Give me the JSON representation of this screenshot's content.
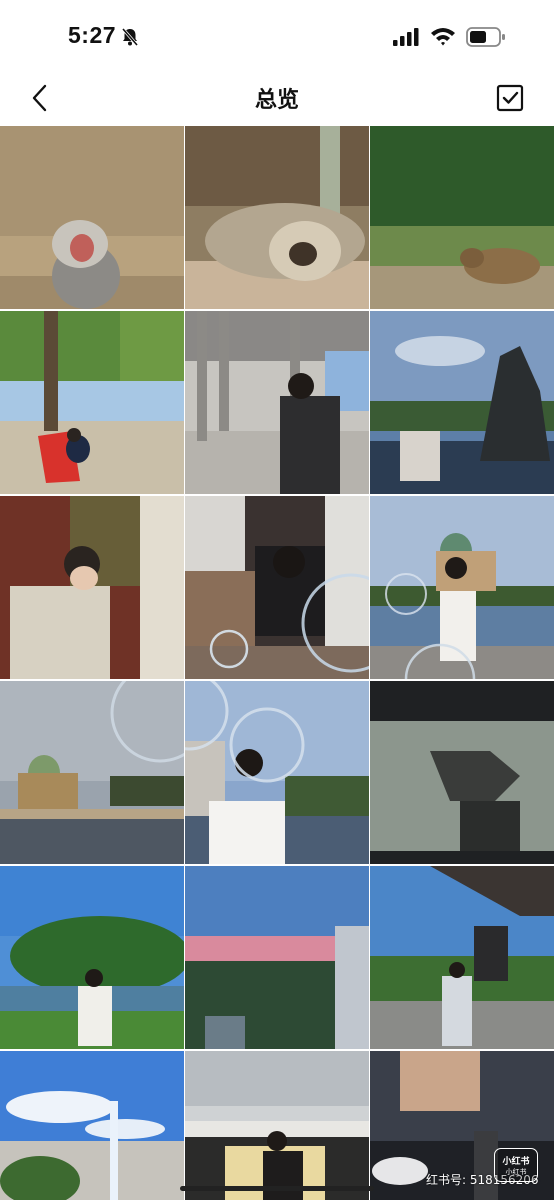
{
  "status_bar": {
    "time": "5:27",
    "icons": [
      "bell-slash-icon",
      "signal-icon",
      "wifi-icon",
      "battery-icon"
    ]
  },
  "nav": {
    "title": "总览",
    "back_icon": "chevron-left-icon",
    "select_icon": "checkbox-icon"
  },
  "grid": {
    "photos": [
      {
        "id": "photo-baboon",
        "icon": "baboon-photo"
      },
      {
        "id": "photo-sloth",
        "icon": "sloth-photo"
      },
      {
        "id": "photo-capybara",
        "icon": "capybara-photo"
      },
      {
        "id": "photo-park-chair",
        "icon": "park-chair-photo"
      },
      {
        "id": "photo-pavilion",
        "icon": "pavilion-photo"
      },
      {
        "id": "photo-fountain",
        "icon": "fountain-photo"
      },
      {
        "id": "photo-brick-wall",
        "icon": "brick-wall-photo"
      },
      {
        "id": "photo-kneeling",
        "icon": "kneeling-photo"
      },
      {
        "id": "photo-cathedral-river",
        "icon": "cathedral-river-photo"
      },
      {
        "id": "photo-cathedral-bridge",
        "icon": "cathedral-bridge-photo"
      },
      {
        "id": "photo-back-view",
        "icon": "back-view-photo"
      },
      {
        "id": "photo-screen",
        "icon": "screen-photo"
      },
      {
        "id": "photo-lake-park",
        "icon": "lake-park-photo"
      },
      {
        "id": "photo-sunset-city",
        "icon": "sunset-city-photo"
      },
      {
        "id": "photo-station",
        "icon": "station-photo"
      },
      {
        "id": "photo-fountain-sky",
        "icon": "fountain-sky-photo"
      },
      {
        "id": "photo-store",
        "icon": "store-photo"
      },
      {
        "id": "photo-night-street",
        "icon": "night-street-photo"
      }
    ]
  },
  "watermark": {
    "text": "红书号: 518156206",
    "logo_text": "小红书",
    "logo_sub": "小红书"
  },
  "colors": {
    "accent": "#111111",
    "background": "#ffffff"
  }
}
